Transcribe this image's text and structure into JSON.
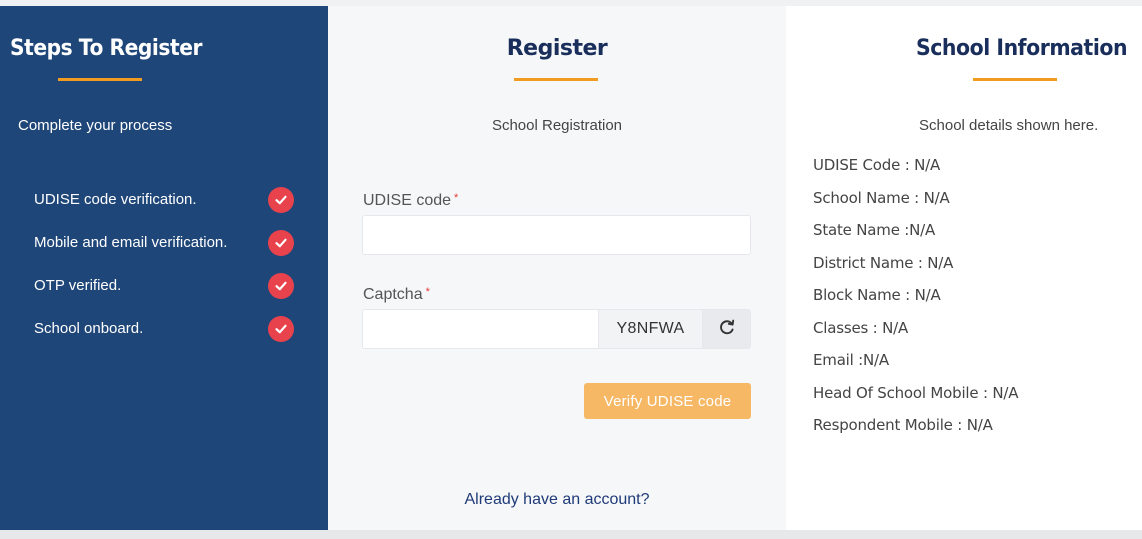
{
  "steps_panel": {
    "title": "Steps To Register",
    "subtitle": "Complete your process",
    "items": [
      {
        "label": "UDISE code verification."
      },
      {
        "label": "Mobile and email verification."
      },
      {
        "label": "OTP verified."
      },
      {
        "label": "School onboard."
      }
    ]
  },
  "register_panel": {
    "title": "Register",
    "subtitle": "School Registration",
    "udise_label": "UDISE code",
    "udise_value": "",
    "captcha_label": "Captcha",
    "captcha_value": "",
    "required_mark": "*",
    "captcha_code": "Y8NFWA",
    "verify_label": "Verify UDISE code",
    "login_link": "Already have an account?"
  },
  "info_panel": {
    "title": "School Information",
    "subtitle": "School details shown here.",
    "rows": [
      {
        "text": "UDISE Code : N/A"
      },
      {
        "text": "School Name : N/A"
      },
      {
        "text": "State Name :N/A"
      },
      {
        "text": "District Name : N/A"
      },
      {
        "text": "Block Name : N/A"
      },
      {
        "text": "Classes : N/A"
      },
      {
        "text": "Email :N/A"
      },
      {
        "text": "Head Of School Mobile : N/A"
      },
      {
        "text": "Respondent Mobile : N/A"
      }
    ]
  },
  "colors": {
    "sidebar_bg": "#1f4678",
    "accent_orange": "#f29b21",
    "check_red": "#e8434d",
    "button_orange": "#f7b866",
    "heading_navy": "#1a2e5c"
  },
  "icons": {
    "step_status": "check-circle-icon",
    "captcha_refresh": "refresh-icon"
  }
}
